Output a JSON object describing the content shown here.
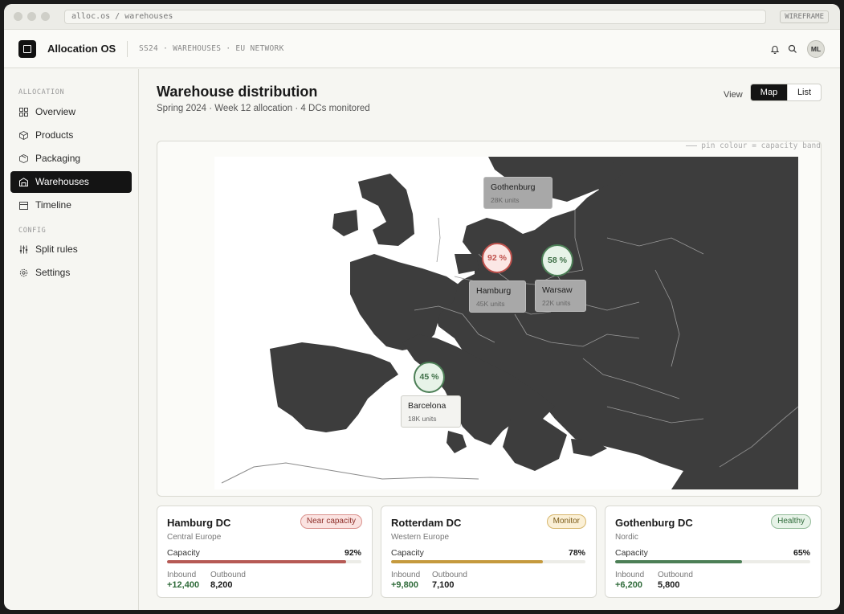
{
  "window": {
    "url": "alloc.os / warehouses",
    "badge": "WIREFRAME"
  },
  "header": {
    "app_name": "Allocation OS",
    "breadcrumb": "SS24 · WAREHOUSES · EU NETWORK",
    "avatar": "ML"
  },
  "sidebar": {
    "sections": [
      {
        "label": "ALLOCATION",
        "items": [
          {
            "label": "Overview",
            "icon": "grid-icon"
          },
          {
            "label": "Products",
            "icon": "box-icon"
          },
          {
            "label": "Packaging",
            "icon": "package-icon"
          },
          {
            "label": "Warehouses",
            "icon": "warehouse-icon",
            "active": true
          },
          {
            "label": "Timeline",
            "icon": "calendar-icon"
          }
        ]
      },
      {
        "label": "CONFIG",
        "items": [
          {
            "label": "Split rules",
            "icon": "sliders-icon"
          },
          {
            "label": "Settings",
            "icon": "gear-icon"
          }
        ]
      }
    ]
  },
  "page": {
    "title": "Warehouse distribution",
    "subtitle": "Spring 2024 · Week 12 allocation · 4 DCs monitored",
    "view_label": "View",
    "views": [
      "Map",
      "List"
    ],
    "active_view": "Map"
  },
  "map": {
    "legend": "pin colour = capacity band",
    "pins": [
      {
        "city": "Gothenburg",
        "units": "28K  units"
      },
      {
        "city": "Hamburg",
        "units": "45K  units",
        "capacity": "92 %",
        "band": "red"
      },
      {
        "city": "Warsaw",
        "units": "22K  units",
        "capacity": "58 %",
        "band": "green"
      },
      {
        "city": "Barcelona",
        "units": "18K  units",
        "capacity": "45 %",
        "band": "green"
      }
    ]
  },
  "cards": [
    {
      "name": "Hamburg DC",
      "status": "Near capacity",
      "region": "Central Europe",
      "capacity_label": "Capacity",
      "capacity": "92%",
      "capacity_fraction": 0.92,
      "bar_color": "#b65a55",
      "inbound_label": "Inbound",
      "inbound": "+12,400",
      "outbound_label": "Outbound",
      "outbound": "8,200"
    },
    {
      "name": "Rotterdam DC",
      "status": "Monitor",
      "region": "Western Europe",
      "capacity_label": "Capacity",
      "capacity": "78%",
      "capacity_fraction": 0.78,
      "bar_color": "#c59a3e",
      "inbound_label": "Inbound",
      "inbound": "+9,800",
      "outbound_label": "Outbound",
      "outbound": "7,100"
    },
    {
      "name": "Gothenburg DC",
      "status": "Healthy",
      "region": "Nordic",
      "capacity_label": "Capacity",
      "capacity": "65%",
      "capacity_fraction": 0.65,
      "bar_color": "#4c7f56",
      "inbound_label": "Inbound",
      "inbound": "+6,200",
      "outbound_label": "Outbound",
      "outbound": "5,800"
    }
  ]
}
